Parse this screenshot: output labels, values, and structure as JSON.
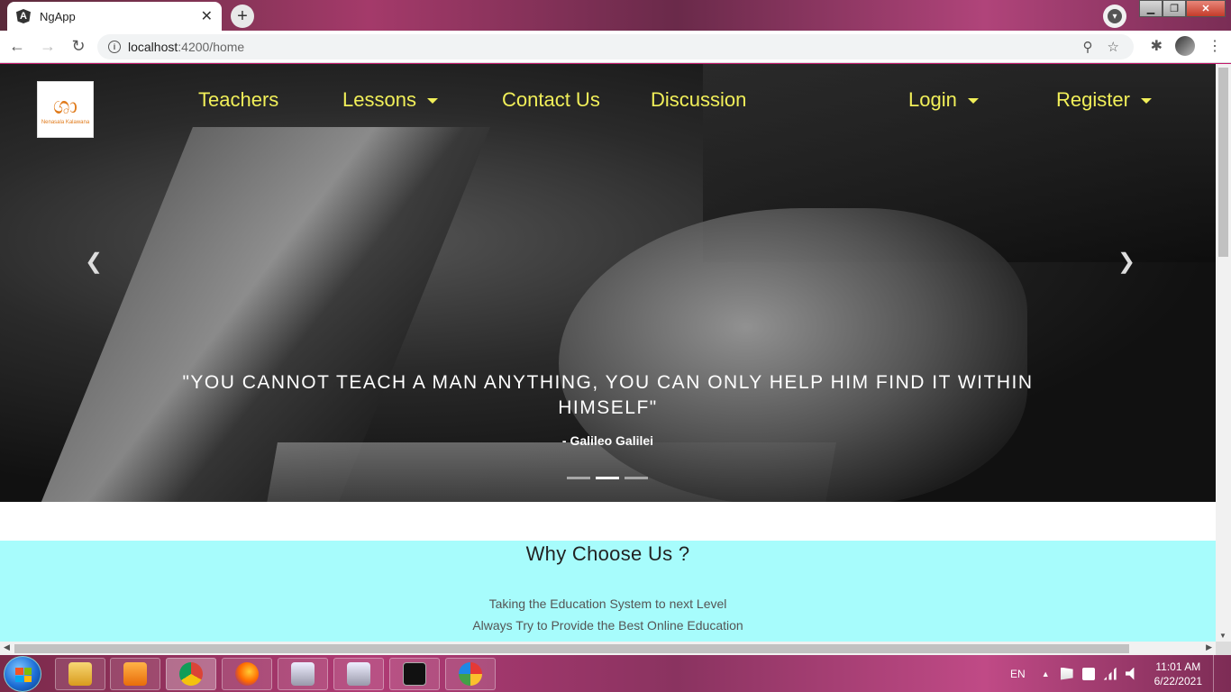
{
  "browser": {
    "tab_title": "NgApp",
    "url_host": "localhost",
    "url_path": ":4200/home"
  },
  "site": {
    "logo_text": "Nenasala Kalawana",
    "nav": {
      "teachers": "Teachers",
      "lessons": "Lessons",
      "contact": "Contact Us",
      "discussion": "Discussion",
      "login": "Login",
      "register": "Register"
    },
    "carousel": {
      "quote": "\"YOU CANNOT TEACH A MAN ANYTHING, YOU CAN ONLY HELP HIM FIND IT WITHIN HIMSELF\"",
      "author": "- Galileo Galilei",
      "slide_count": 3,
      "active_slide": 2
    },
    "why": {
      "title": "Why Choose Us ?",
      "line1": "Taking the Education System to next Level",
      "line2": "Always Try to Provide the Best Online Education"
    }
  },
  "taskbar": {
    "language": "EN",
    "time": "11:01 AM",
    "date": "6/22/2021"
  },
  "colors": {
    "nav_text": "#f1ef59",
    "why_bg": "#a7fcfc"
  }
}
